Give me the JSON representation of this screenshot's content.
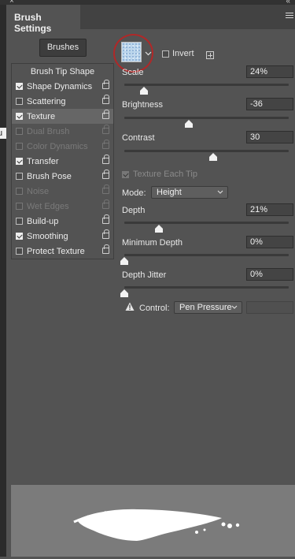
{
  "window": {
    "title": "Brush Settings",
    "close_glyph": "×",
    "collapse_glyph": "«",
    "left_fragment": "u"
  },
  "toolbar": {
    "brushes_label": "Brushes",
    "invert_label": "Invert",
    "invert_checked": false
  },
  "brush_list": {
    "header": "Brush Tip Shape",
    "items": [
      {
        "label": "Shape Dynamics",
        "checked": true,
        "enabled": true
      },
      {
        "label": "Scattering",
        "checked": false,
        "enabled": true
      },
      {
        "label": "Texture",
        "checked": true,
        "enabled": true,
        "selected": true
      },
      {
        "label": "Dual Brush",
        "checked": false,
        "enabled": false
      },
      {
        "label": "Color Dynamics",
        "checked": false,
        "enabled": false
      },
      {
        "label": "Transfer",
        "checked": true,
        "enabled": true
      },
      {
        "label": "Brush Pose",
        "checked": false,
        "enabled": true
      },
      {
        "label": "Noise",
        "checked": false,
        "enabled": false
      },
      {
        "label": "Wet Edges",
        "checked": false,
        "enabled": false
      },
      {
        "label": "Build-up",
        "checked": false,
        "enabled": true
      },
      {
        "label": "Smoothing",
        "checked": true,
        "enabled": true
      },
      {
        "label": "Protect Texture",
        "checked": false,
        "enabled": true
      }
    ]
  },
  "texture": {
    "scale": {
      "label": "Scale",
      "value": "24%",
      "slider_fraction": 0.12
    },
    "brightness": {
      "label": "Brightness",
      "value": "-36",
      "slider_fraction": 0.39
    },
    "contrast": {
      "label": "Contrast",
      "value": "30",
      "slider_fraction": 0.54
    },
    "texture_each_tip": {
      "label": "Texture Each Tip",
      "checked": true,
      "enabled": false
    },
    "mode": {
      "label": "Mode:",
      "value": "Height"
    },
    "depth": {
      "label": "Depth",
      "value": "21%",
      "slider_fraction": 0.21
    },
    "minimum_depth": {
      "label": "Minimum Depth",
      "value": "0%",
      "slider_fraction": 0.0
    },
    "depth_jitter": {
      "label": "Depth Jitter",
      "value": "0%",
      "slider_fraction": 0.0
    },
    "control": {
      "label": "Control:",
      "value": "Pen Pressure"
    }
  },
  "colors": {
    "panel": "#535353",
    "highlight_ring": "#b02828",
    "preview_bg": "#7b7b7b",
    "stroke": "#ffffff"
  },
  "icons": [
    "close-icon",
    "collapse-icon",
    "panel-menu-icon",
    "texture-swatch",
    "new-preset-icon",
    "lock-icon",
    "warning-icon"
  ]
}
